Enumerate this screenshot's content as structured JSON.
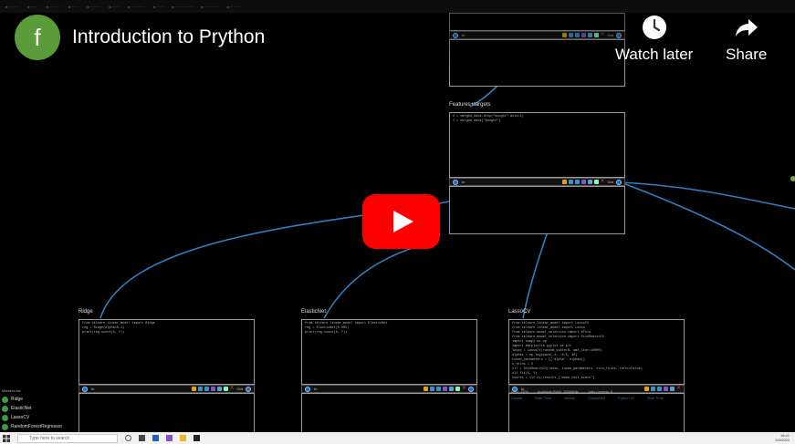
{
  "video": {
    "title": "Introduction to Prython",
    "channel_initial": "f",
    "watch_later_label": "Watch later",
    "share_label": "Share"
  },
  "cells": {
    "top": {
      "toolbar_label": "In",
      "toolbar_right": "Out"
    },
    "features": {
      "title": "Features+targets",
      "code": [
        "X = merged_data.drop(\"bought\",axis=1)",
        "Y = merged_data[\"bought\"]"
      ],
      "toolbar_label": "In",
      "toolbar_right": "Out"
    },
    "ridge": {
      "title": "Ridge",
      "code": [
        "from sklearn.linear_model import Ridge",
        "reg = Ridge(alpha=0.1)",
        "print(reg.score(X, Y))"
      ],
      "toolbar_label": "In",
      "toolbar_right": "Out"
    },
    "elasticnet": {
      "title": "ElasticNet",
      "code": [
        "from sklearn.linear_model import ElasticNet",
        "reg = ElasticNet(0.005)",
        "print(reg.score(X, Y))"
      ],
      "toolbar_label": "In",
      "toolbar_right": "Out"
    },
    "lassocv": {
      "title": "LassoCV",
      "code": [
        "from sklearn.linear_model import LassoCV",
        "from sklearn.linear_model import Lasso",
        "from sklearn.model_selection import KFold",
        "from sklearn.model_selection import GridSearchCV",
        "import numpy as np",
        "import matplotlib.pyplot as plt",
        "",
        "lasso = LassoCV(random_state=0, max_iter=10000)",
        "alphas = np.logspace(-4, -0.5, 30)",
        "",
        "tuned_parameters = [{'alpha': alphas}]",
        "n_folds = 5",
        "",
        "clf = GridSearchCV(lasso, tuned_parameters, cv=n_folds, refit=False)",
        "clf.fit(X, Y)",
        "scores = clf.cv_results_['mean_test_score']"
      ],
      "toolbar_label": "In",
      "toolbar_right": "Out"
    }
  },
  "markers": {
    "title": "Markers list",
    "items": [
      "Ridge",
      "ElasticNet",
      "LassoCV",
      "RandomForestRegressor"
    ]
  },
  "status": {
    "cpu": "CPU: 22%",
    "ram": "Available RAM: 25568Mb",
    "jobs": "Jobs running: 0",
    "columns": [
      "Create",
      "Start Time",
      "Needs",
      "Completed",
      "Python ID",
      "Start Time"
    ]
  },
  "taskbar": {
    "search_placeholder": "Type here to search",
    "time": "18:41",
    "date": "2/4/2020"
  },
  "colors": {
    "wire": "#2f7fc1",
    "play_red": "#ff0000",
    "channel_green": "#5a9b3a"
  }
}
